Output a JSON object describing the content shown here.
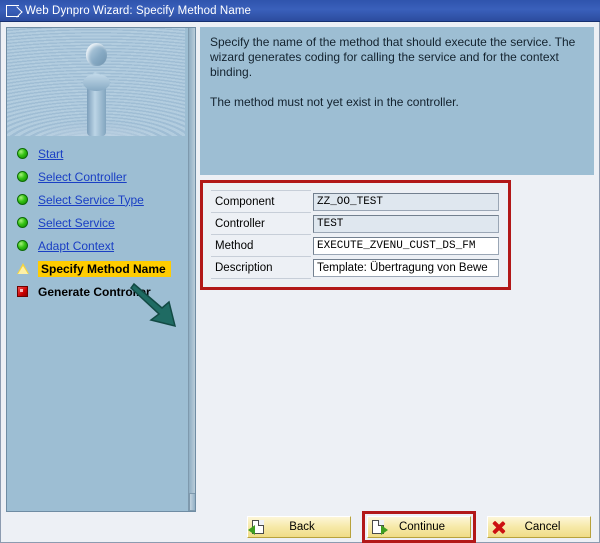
{
  "window": {
    "title": "Web Dynpro Wizard: Specify Method Name",
    "title_icon": "window-export-icon"
  },
  "sidebar": {
    "image_name": "water-droplet-splash-image",
    "items": [
      {
        "label": "Start",
        "status": "done",
        "icon": "green-sphere-icon"
      },
      {
        "label": "Select Controller",
        "status": "done",
        "icon": "green-sphere-icon"
      },
      {
        "label": "Select Service Type",
        "status": "done",
        "icon": "green-sphere-icon"
      },
      {
        "label": "Select Service",
        "status": "done",
        "icon": "green-sphere-icon"
      },
      {
        "label": "Adapt Context",
        "status": "done",
        "icon": "green-sphere-icon"
      },
      {
        "label": "Specify Method Name",
        "status": "current",
        "icon": "yellow-warning-triangle-icon"
      },
      {
        "label": "Generate Controller",
        "status": "pending",
        "icon": "red-square-icon"
      }
    ],
    "annotation_arrow": "green-pointer-arrow"
  },
  "instructions": {
    "paragraph1": "Specify the name of the method that should execute the service. The wizard generates coding for calling the service and for the context binding.",
    "paragraph2": "The method must not yet exist in the controller."
  },
  "form": {
    "fields": [
      {
        "label": "Component",
        "value": "ZZ_OO_TEST",
        "readonly": true,
        "mono": true
      },
      {
        "label": "Controller",
        "value": "TEST",
        "readonly": true,
        "mono": true
      },
      {
        "label": "Method",
        "value": "EXECUTE_ZVENU_CUST_DS_FM",
        "readonly": false,
        "mono": true
      },
      {
        "label": "Description",
        "value": "Template: Übertragung von Bewe",
        "readonly": false,
        "mono": false
      }
    ],
    "annotation_color": "#b21818"
  },
  "toolbar": {
    "back_label": "Back",
    "continue_label": "Continue",
    "cancel_label": "Cancel",
    "back_icon": "page-back-arrow-icon",
    "continue_icon": "page-forward-arrow-icon",
    "cancel_icon": "red-x-icon"
  },
  "colors": {
    "titlebar": "#2f54ad",
    "panel_blue": "#9dbed3",
    "body_bg": "#edf0f5",
    "highlight_yellow": "#ffcc00",
    "annotation_red": "#b21818",
    "button_yellow": "#f6e9a8"
  }
}
